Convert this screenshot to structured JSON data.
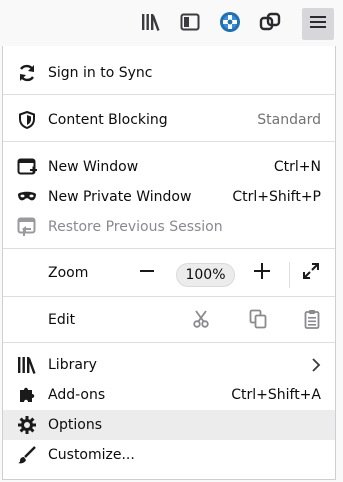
{
  "toolbar": {
    "icons": [
      "library-icon",
      "sidebars-icon",
      "extension-icon",
      "sync-tabs-icon",
      "hamburger-menu-icon"
    ]
  },
  "menu": {
    "sign_in": "Sign in to Sync",
    "content_blocking": "Content Blocking",
    "content_blocking_status": "Standard",
    "new_window": "New Window",
    "new_window_shortcut": "Ctrl+N",
    "new_private_window": "New Private Window",
    "new_private_window_shortcut": "Ctrl+Shift+P",
    "restore_session": "Restore Previous Session",
    "zoom": "Zoom",
    "zoom_value": "100%",
    "edit": "Edit",
    "library": "Library",
    "addons": "Add-ons",
    "addons_shortcut": "Ctrl+Shift+A",
    "options": "Options",
    "customize": "Customize..."
  },
  "colors": {
    "accent_blue": "#0a84ff",
    "hover_bg": "#ececed",
    "disabled_text": "#8a8a8e"
  }
}
